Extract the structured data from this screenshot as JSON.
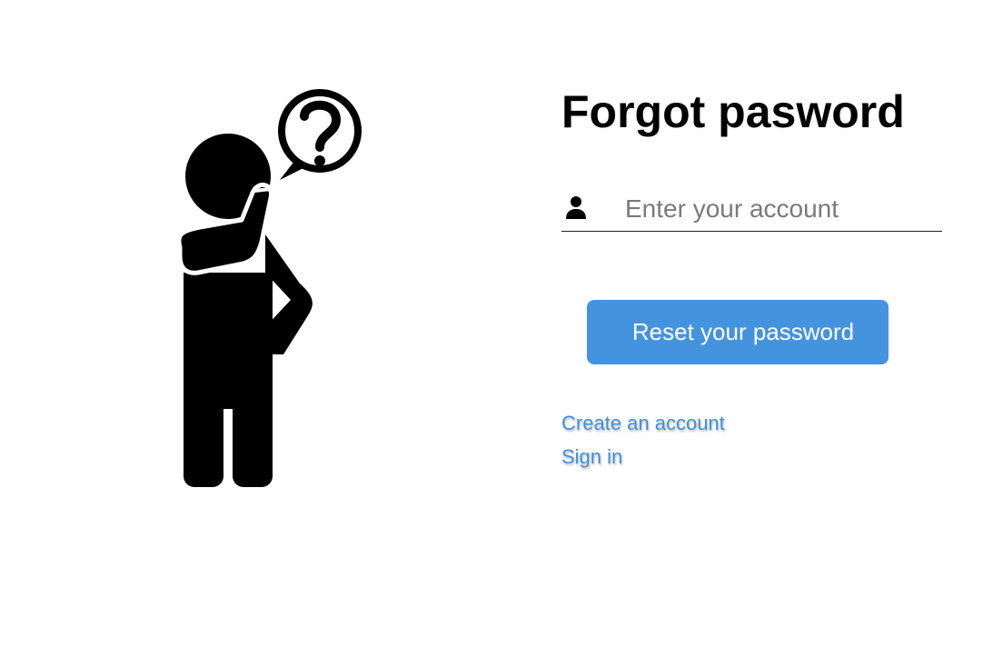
{
  "form": {
    "title": "Forgot pasword",
    "account_input": {
      "value": "",
      "placeholder": "Enter your account",
      "icon": "user-icon"
    },
    "reset_button_label": "Reset your password"
  },
  "links": {
    "create_account": "Create an account",
    "sign_in": "Sign in"
  },
  "illustration": {
    "icon": "confused-person-question-icon"
  },
  "colors": {
    "accent": "#4493de",
    "link": "#3f8fdf",
    "text": "#000000",
    "placeholder": "#7a7a7a"
  }
}
